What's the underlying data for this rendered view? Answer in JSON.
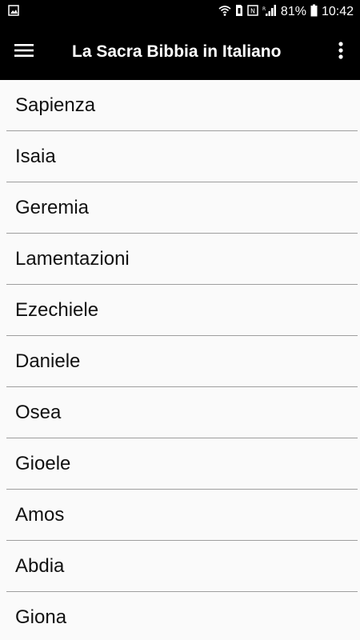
{
  "status_bar": {
    "battery_percent": "81%",
    "time": "10:42"
  },
  "app_bar": {
    "title": "La Sacra Bibbia in Italiano",
    "icons": [
      "menu-icon",
      "more-vert-icon"
    ]
  },
  "books": [
    {
      "label": "Sapienza"
    },
    {
      "label": "Isaia"
    },
    {
      "label": "Geremia"
    },
    {
      "label": "Lamentazioni"
    },
    {
      "label": "Ezechiele"
    },
    {
      "label": "Daniele"
    },
    {
      "label": "Osea"
    },
    {
      "label": "Gioele"
    },
    {
      "label": "Amos"
    },
    {
      "label": "Abdia"
    },
    {
      "label": "Giona"
    }
  ]
}
